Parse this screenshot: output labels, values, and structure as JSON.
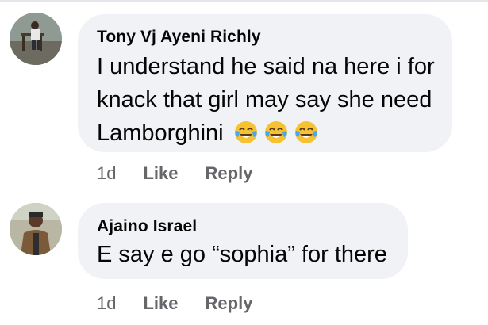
{
  "comments": [
    {
      "author": "Tony Vj Ayeni Richly",
      "text_lines": [
        "I understand he said na here i for",
        "knack that girl may say she need",
        "Lamborghini"
      ],
      "emojis": [
        "face-with-tears-of-joy-icon",
        "face-with-tears-of-joy-icon",
        "face-with-tears-of-joy-icon"
      ],
      "time": "1d",
      "like_label": "Like",
      "reply_label": "Reply"
    },
    {
      "author": "Ajaino Israel",
      "text_lines": [
        "E say e go “sophia” for there"
      ],
      "time": "1d",
      "like_label": "Like",
      "reply_label": "Reply"
    }
  ],
  "colors": {
    "bubble": "#f0f2f5",
    "text": "#050505",
    "secondary_text": "#65676b",
    "emoji_face": "#f7c22f",
    "emoji_tears": "#47a7f2"
  }
}
